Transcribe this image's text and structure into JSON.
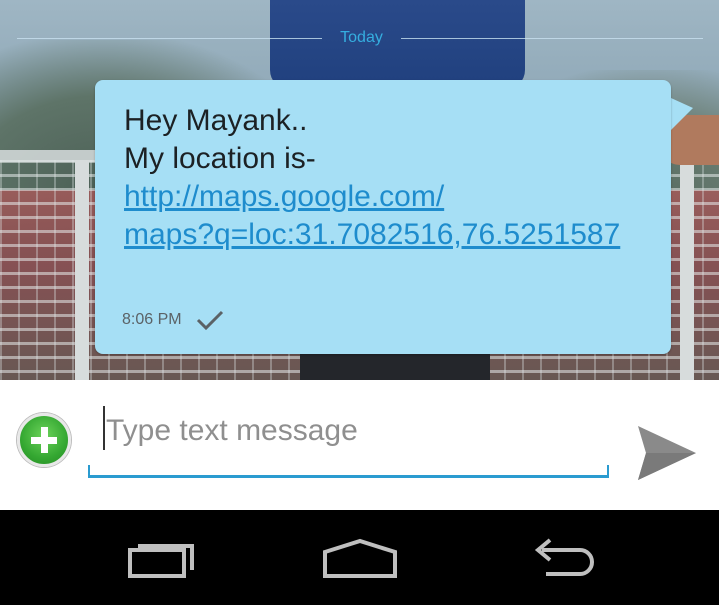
{
  "conversation": {
    "date_divider": "Today",
    "message": {
      "lines": [
        "Hey Mayank..",
        "My location is-"
      ],
      "link_lines": [
        "http://maps.google.com/",
        "maps?q=loc:31.7082516,76.5251587"
      ],
      "time": "8:06 PM",
      "status_icon": "checkmark-icon"
    }
  },
  "compose": {
    "attach_icon": "plus-icon",
    "input_placeholder": "Type text message",
    "input_value": "",
    "send_icon": "send-icon"
  },
  "nav_bar": {
    "buttons": [
      "recent-apps-icon",
      "home-icon",
      "back-icon"
    ]
  },
  "colors": {
    "bubble": "#a6dff5",
    "link": "#1e8ccd",
    "accent": "#2a9bd0",
    "date_text": "#35aee0"
  }
}
